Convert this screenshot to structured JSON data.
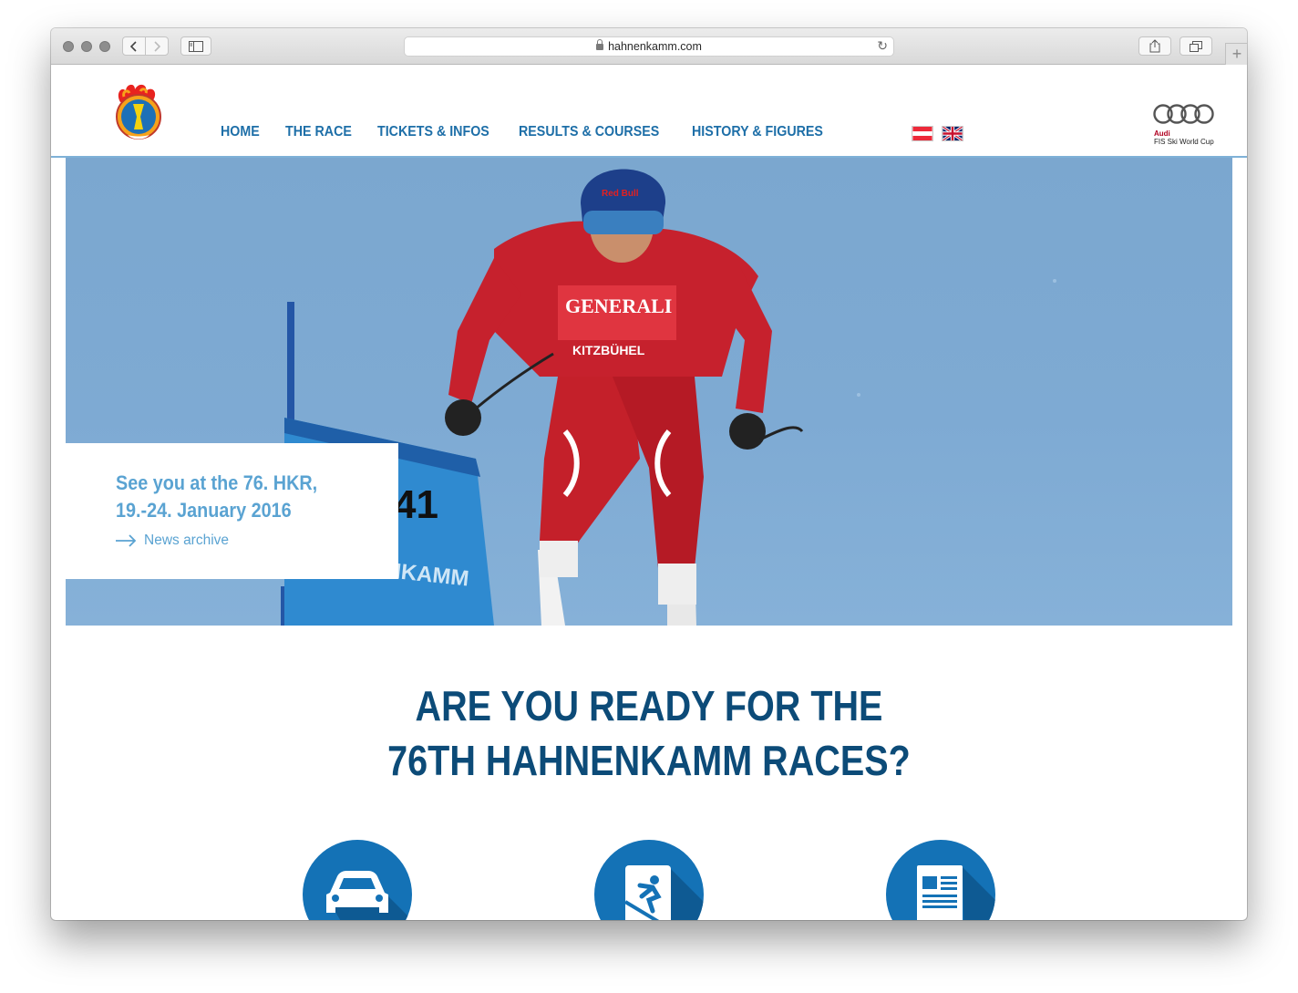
{
  "browser": {
    "url": "hahnenkamm.com"
  },
  "nav": {
    "items": [
      {
        "label": "HOME"
      },
      {
        "label": "THE RACE"
      },
      {
        "label": "TICKETS & INFOS"
      },
      {
        "label": "RESULTS & COURSES"
      },
      {
        "label": "HISTORY & FIGURES"
      }
    ],
    "languages": [
      "austrian-flag-icon",
      "uk-flag-icon"
    ]
  },
  "sponsor": {
    "brand": "Audi",
    "subtitle": "FIS Ski World Cup"
  },
  "hero": {
    "news_title_line1": "See you at the 76. HKR,",
    "news_title_line2": "19.-24. January 2016",
    "news_link": "News archive",
    "banner_text": "NKAMM",
    "bib_number": "41",
    "suit_text": "GENERALI",
    "suit_text2": "KITZBÜHEL",
    "helmet_text": "Red Bull"
  },
  "main": {
    "headline_line1": "ARE YOU READY FOR THE",
    "headline_line2": "76TH HAHNENKAMM RACES?",
    "features": [
      {
        "icon": "car-icon"
      },
      {
        "icon": "skier-icon"
      },
      {
        "icon": "newspaper-icon"
      }
    ]
  },
  "colors": {
    "nav": "#1e6fa8",
    "headline": "#0c4b78",
    "news": "#5aa3d2",
    "circle": "#1472b6",
    "sky": "#7ba7cf"
  }
}
